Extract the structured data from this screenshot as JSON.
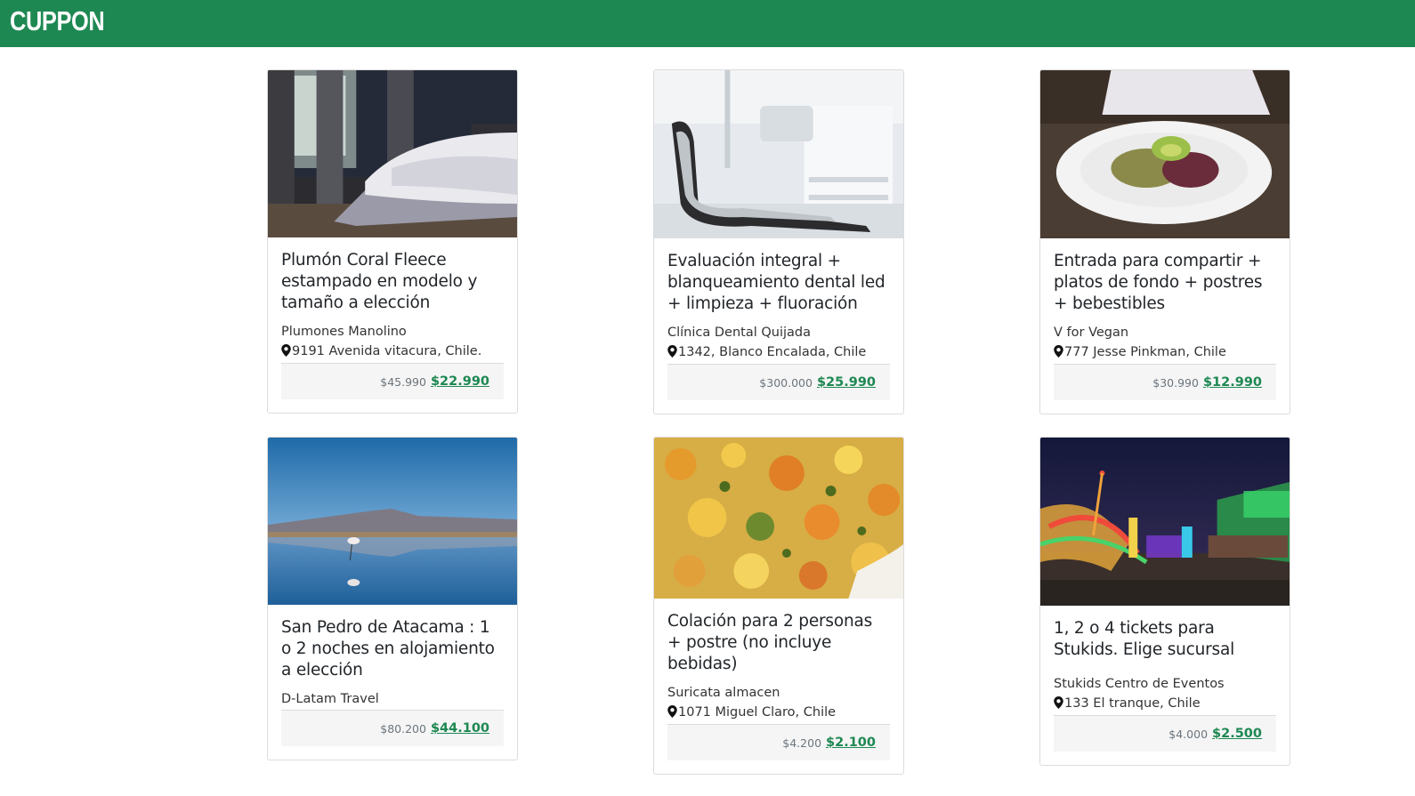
{
  "header": {
    "brand": "CUPPON",
    "brand_color": "#1e8853"
  },
  "cards": [
    {
      "image": "bedroom-photo",
      "title": "Plumón Coral Fleece estampado en modelo y tamaño a elección",
      "vendor": "Plumones Manolino",
      "address": "9191 Avenida vitacura, Chile.",
      "old_price": "$45.990",
      "new_price": "$22.990"
    },
    {
      "image": "dental-clinic-photo",
      "title": "Evaluación integral + blanqueamiento dental led + limpieza + fluoración",
      "vendor": "Clínica Dental Quijada",
      "address": "1342, Blanco Encalada, Chile",
      "old_price": "$300.000",
      "new_price": "$25.990"
    },
    {
      "image": "vegan-salad-photo",
      "title": "Entrada para compartir + platos de fondo + postres + bebestibles",
      "vendor": "V for Vegan",
      "address": "777 Jesse Pinkman, Chile",
      "old_price": "$30.990",
      "new_price": "$12.990"
    },
    {
      "image": "flamingo-lake-photo",
      "title": "San Pedro de Atacama : 1 o 2 noches en alojamiento a elección",
      "vendor": "D-Latam Travel",
      "address": "",
      "old_price": "$80.200",
      "new_price": "$44.100"
    },
    {
      "image": "stew-food-photo",
      "title": "Colación para 2 personas + postre (no incluye bebidas)",
      "vendor": "Suricata almacen",
      "address": "1071 Miguel Claro, Chile",
      "old_price": "$4.200",
      "new_price": "$2.100"
    },
    {
      "image": "fair-night-photo",
      "title": "1, 2 o 4 tickets para Stukids. Elige sucursal",
      "vendor": "Stukids Centro de Eventos",
      "address": "133 El tranque, Chile",
      "old_price": "$4.000",
      "new_price": "$2.500"
    }
  ]
}
